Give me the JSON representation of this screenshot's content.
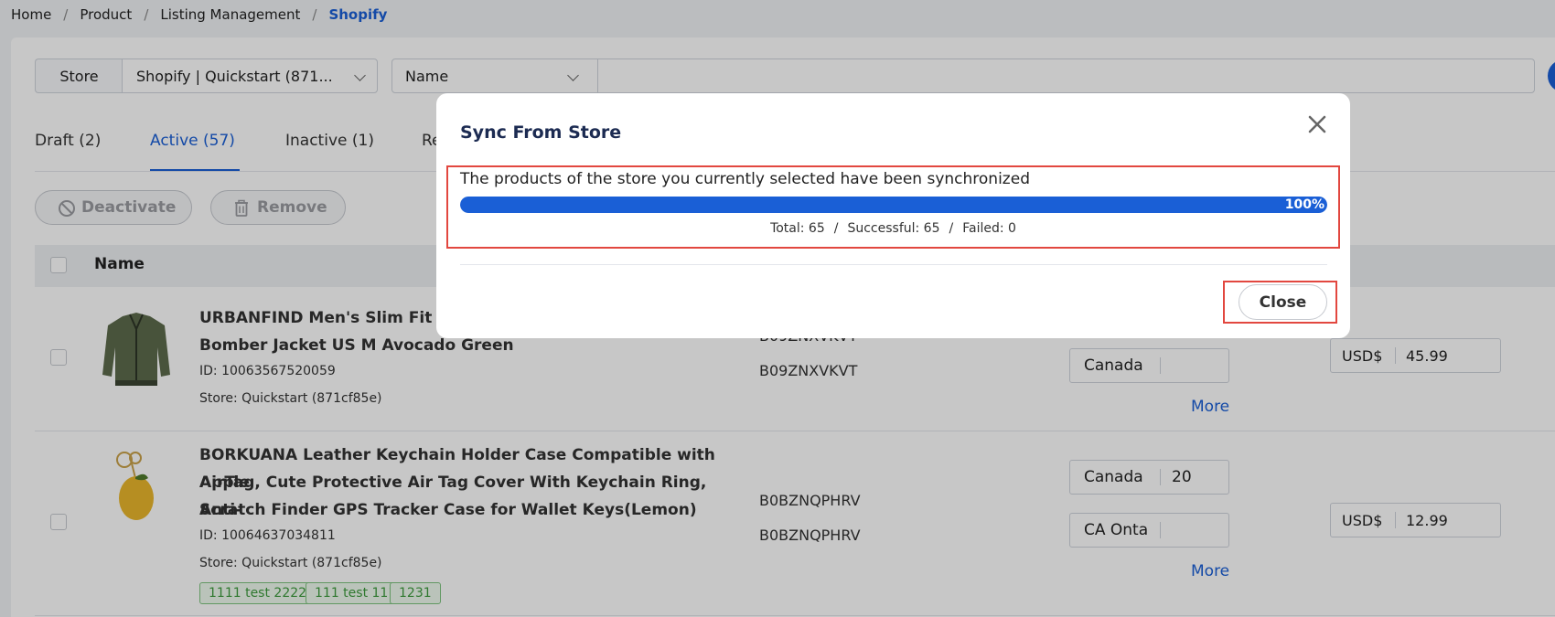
{
  "breadcrumb": {
    "items": [
      "Home",
      "Product",
      "Listing Management"
    ],
    "current": "Shopify",
    "separator": "/"
  },
  "filters": {
    "store_label": "Store",
    "store_value": "Shopify | Quickstart (871...",
    "field_value": "Name"
  },
  "tabs": [
    {
      "label": "Draft (2)"
    },
    {
      "label": "Active (57)"
    },
    {
      "label": "Inactive (1)"
    },
    {
      "label": "Re"
    }
  ],
  "actions": {
    "deactivate_label": "Deactivate",
    "remove_label": "Remove"
  },
  "table": {
    "name_header": "Name",
    "rows": [
      {
        "title": "URBANFIND Men's Slim Fit Ligh… Bomber Jacket US M Avocado Green",
        "title_line1": "URBANFIND Men's Slim Fit Ligh",
        "title_line2": "Bomber Jacket US M Avocado Green",
        "id": "ID: 10063567520059",
        "store": "Store: Quickstart (871cf85e)",
        "asins": [
          "B09ZNXVKVT",
          "B09ZNXVKVT"
        ],
        "markets": [
          {
            "name": "Canada",
            "qty": ""
          }
        ],
        "more_label": "More",
        "currency": "USD$",
        "price": "45.99",
        "tags": []
      },
      {
        "title": "BORKUANA Leather Keychain Holder Case Compatible with Apple AirTag, Cute Protective Air Tag Cover With Keychain Ring, Anti-Scratch Finder GPS Tracker Case for Wallet Keys(Lemon)",
        "title_line1": "BORKUANA Leather Keychain Holder Case Compatible with Apple",
        "title_line2": "AirTag, Cute Protective Air Tag Cover With Keychain Ring, Anti-",
        "title_line3": "Scratch Finder GPS Tracker Case for Wallet Keys(Lemon)",
        "id": "ID: 10064637034811",
        "store": "Store: Quickstart (871cf85e)",
        "asins": [
          "B0BZNQPHRV",
          "B0BZNQPHRV"
        ],
        "markets": [
          {
            "name": "Canada",
            "qty": "20"
          },
          {
            "name": "CA Onta",
            "qty": ""
          }
        ],
        "more_label": "More",
        "currency": "USD$",
        "price": "12.99",
        "tags": [
          "1111 test 2222",
          "111 test 111",
          "1231"
        ]
      }
    ]
  },
  "modal": {
    "title": "Sync From Store",
    "message": "The products of the store you currently selected have been synchronized",
    "progress_percent": 100,
    "progress_label": "100%",
    "total": "Total: 65",
    "successful": "Successful: 65",
    "failed": "Failed: 0",
    "close_label": "Close"
  },
  "colors": {
    "accent": "#1a5fd6",
    "highlight": "#e2473f",
    "tag_green": "#3d9b3d",
    "title_navy": "#1c2b52"
  }
}
